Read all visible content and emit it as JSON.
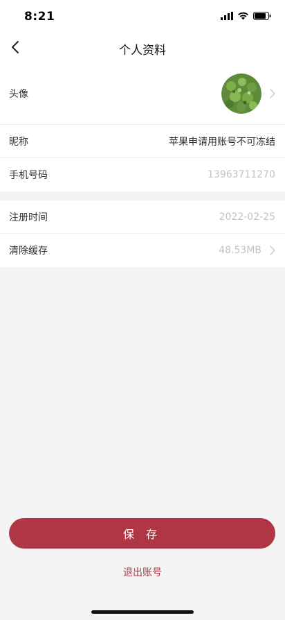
{
  "status_bar": {
    "time": "8:21"
  },
  "header": {
    "title": "个人资料"
  },
  "profile": {
    "avatar_label": "头像",
    "nickname_label": "昵称",
    "nickname_value": "苹果申请用账号不可冻结",
    "phone_label": "手机号码",
    "phone_value": "13963711270"
  },
  "account": {
    "register_label": "注册时间",
    "register_value": "2022-02-25",
    "cache_label": "清除缓存",
    "cache_value": "48.53MB"
  },
  "actions": {
    "save_label": "保 存",
    "logout_label": "退出账号"
  },
  "colors": {
    "accent": "#b03545",
    "muted_text": "#c2c2c2",
    "background": "#f4f4f4"
  }
}
